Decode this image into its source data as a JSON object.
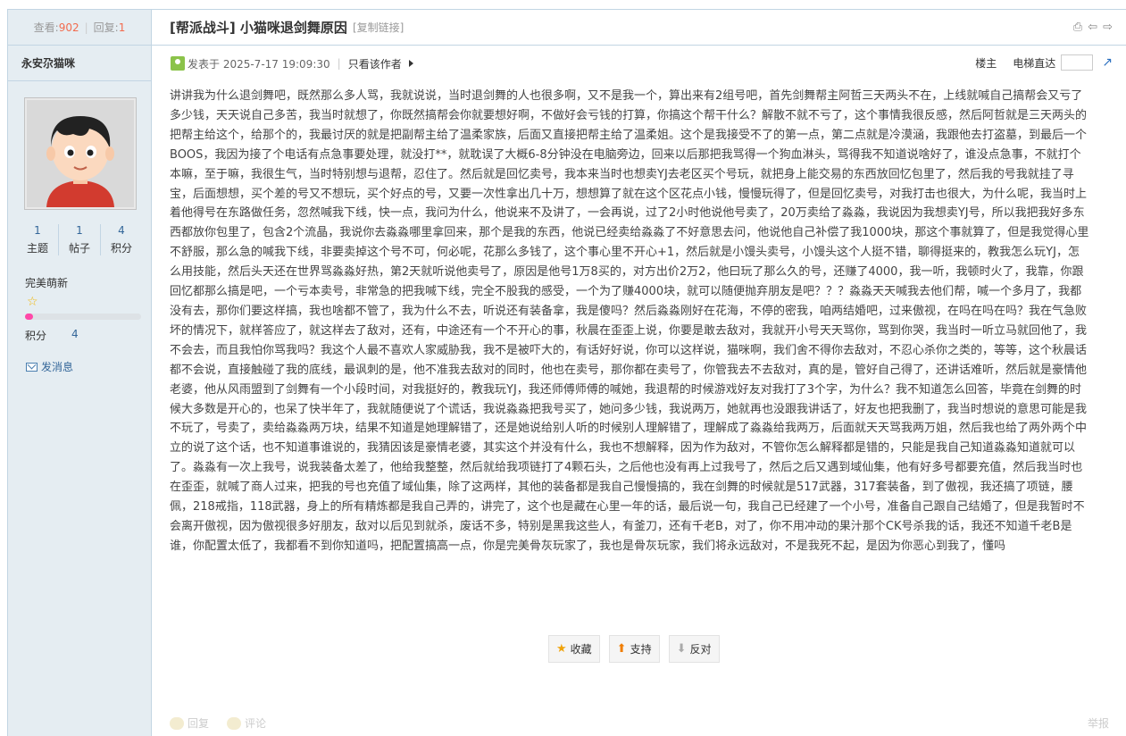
{
  "sidebar": {
    "views_label": "查看:",
    "views_count": "902",
    "replies_label": "回复:",
    "replies_count": "1",
    "author_name": "永安尕猫咪",
    "stats": [
      {
        "value": "1",
        "label": "主题"
      },
      {
        "value": "1",
        "label": "帖子"
      },
      {
        "value": "4",
        "label": "积分"
      }
    ],
    "rank_name": "完美萌新",
    "rank_progress_fraction": 0.07,
    "points_label": "积分",
    "points_value": "4",
    "message_label": "发消息"
  },
  "header": {
    "title": "[帮派战斗] 小猫咪退剑舞原因",
    "copy_link": "[复制链接]"
  },
  "post_info": {
    "posted_at": "发表于 2025-7-17 19:09:30",
    "only_author": "只看该作者",
    "floor_label": "楼主",
    "jump_label": "电梯直达"
  },
  "post": {
    "body": "讲讲我为什么退剑舞吧，既然那么多人骂，我就说说，当时退剑舞的人也很多啊，又不是我一个，算出来有2组号吧，首先剑舞帮主阿哲三天两头不在，上线就喊自己搞帮会又亏了多少钱，天天说自己多苦，我当时就想了，你既然搞帮会你就要想好啊，不做好会亏钱的打算，你搞这个帮干什么？解散不就不亏了，这个事情我很反感，然后阿哲就是三天两头的把帮主给这个，给那个的，我最讨厌的就是把副帮主给了温柔家族，后面又直接把帮主给了温柔姐。这个是我接受不了的第一点，第二点就是冷漠涵，我跟他去打盗墓，到最后一个BOOS，我因为接了个电话有点急事要处理，就没打**，就耽误了大概6-8分钟没在电脑旁边，回来以后那把我骂得一个狗血淋头，骂得我不知道说啥好了，谁没点急事，不就打个本嘛，至于嘛，我很生气，当时特别想与退帮，忍住了。然后就是回忆卖号，我本来当时也想卖YJ去老区买个号玩，就把身上能交易的东西放回忆包里了，然后我的号我就挂了寻宝，后面想想，买个差的号又不想玩，买个好点的号，又要一次性拿出几十万，想想算了就在这个区花点小钱，慢慢玩得了，但是回忆卖号，对我打击也很大，为什么呢，我当时上着他得号在东路做任务，忽然喊我下线，快一点，我问为什么，他说来不及讲了，一会再说，过了2小时他说他号卖了，20万卖给了淼淼，我说因为我想卖YJ号，所以我把我好多东西都放你包里了，包含2个流晶，我说你去淼淼哪里拿回来，那个是我的东西，他说已经卖给淼淼了不好意思去问，他说他自己补偿了我1000块，那这个事就算了，但是我觉得心里不舒服，那么急的喊我下线，非要卖掉这个号不可，何必呢，花那么多钱了，这个事心里不开心+1，然后就是小馒头卖号，小馒头这个人挺不错，聊得挺来的，教我怎么玩YJ，怎么用技能，然后头天还在世界骂淼淼好热，第2天就听说他卖号了，原因是他号1万8买的，对方出价2万2，他曰玩了那么久的号，还赚了4000，我一听，我顿时火了，我靠，你跟回忆都那么搞是吧，一个亏本卖号，非常急的把我喊下线，完全不股我的感受，一个为了赚4000块，就可以随便抛弃朋友是吧？？？淼淼天天喊我去他们帮，喊一个多月了，我都没有去，那你们要这样搞，我也啥都不管了，我为什么不去，听说还有装备拿，我是傻吗？然后淼淼刚好在花海，不停的密我，咱两结婚吧，过来傲视，在吗在吗在吗？我在气急败坏的情况下，就样答应了，就这样去了敌对，还有，中途还有一个不开心的事，秋晨在歪歪上说，你要是敢去敌对，我就开小号天天骂你，骂到你哭，我当时一听立马就回他了，我不会去，而且我怕你骂我吗？我这个人最不喜欢人家威胁我，我不是被吓大的，有话好好说，你可以这样说，猫咪啊，我们舍不得你去敌对，不忍心杀你之类的，等等，这个秋晨话都不会说，直接触碰了我的底线，最讽刺的是，他不准我去敌对的同时，他也在卖号，那你都在卖号了，你管我去不去敌对，真的是，管好自己得了，还讲话难听，然后就是豪情他老婆，他从风雨盟到了剑舞有一个小段时间，对我挺好的，教我玩YJ，我还师傅师傅的喊她，我退帮的时候游戏好友对我打了3个字，为什么？我不知道怎么回答，毕竟在剑舞的时候大多数是开心的，也呆了快半年了，我就随便说了个谎话，我说淼淼把我号买了，她问多少钱，我说两万，她就再也没跟我讲话了，好友也把我删了，我当时想说的意思可能是我不玩了，号卖了，卖给淼淼两万块，结果不知道是她理解错了，还是她说给别人听的时候别人理解错了，理解成了淼淼给我两万，后面就天天骂我两万姐，然后我也给了两外两个中立的说了这个话，也不知道事谁说的，我猜因该是豪情老婆，其实这个并没有什么，我也不想解释，因为作为敌对，不管你怎么解释都是错的，只能是我自己知道淼淼知道就可以了。淼淼有一次上我号，说我装备太差了，他给我整整，然后就给我项链打了4颗石头，之后他也没有再上过我号了，然后之后又遇到域仙集，他有好多号都要充值，然后我当时也在歪歪，就喊了商人过来，把我的号也充值了域仙集，除了这两样，其他的装备都是我自己慢慢搞的，我在剑舞的时候就是517武器，317套装备，到了傲视，我还搞了项链，腰佩，218戒指，118武器，身上的所有精炼都是我自己弄的，讲完了，这个也是藏在心里一年的话，最后说一句，我自己已经建了一个小号，准备自己跟自己结婚了，但是我暂时不会离开傲视，因为傲视很多好朋友，敌对以后见到就杀，废话不多，特别是黑我这些人，有釜刀，还有千老B，对了，你不用冲动的果汁那个CK号杀我的话，我还不知道千老B是谁，你配置太低了，我都看不到你知道吗，把配置搞高一点，你是完美骨灰玩家了，我也是骨灰玩家，我们将永远敌对，不是我死不起，是因为你恶心到我了，懂吗"
  },
  "actions": {
    "favorite": "收藏",
    "support": "支持",
    "oppose": "反对"
  },
  "footer": {
    "reply": "回复",
    "comment": "评论",
    "report": "举报"
  },
  "colors": {
    "sidebar_bg": "#e5edf2",
    "border": "#c2d5e3",
    "link_blue": "#336699",
    "count_red": "#f26c4f",
    "progress_pink": "#ff48a8"
  }
}
